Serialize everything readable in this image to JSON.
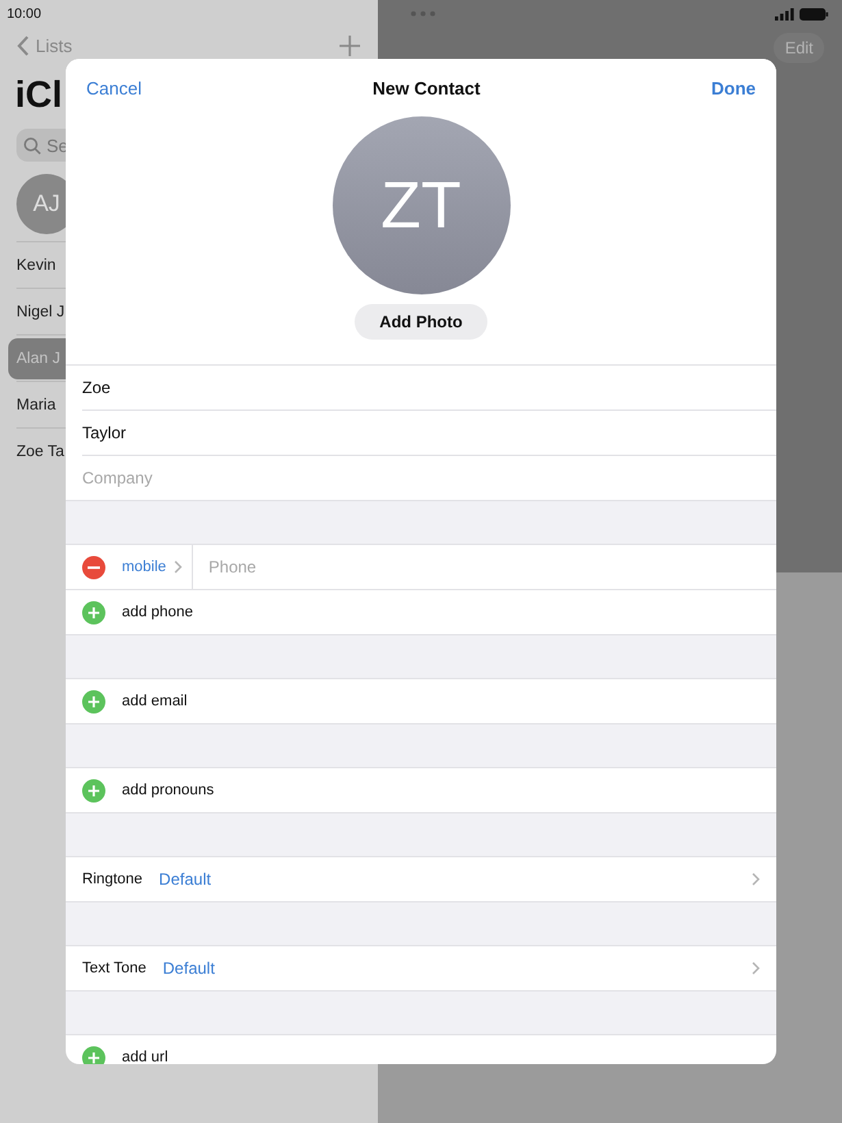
{
  "status_bar": {
    "time": "10:00"
  },
  "background": {
    "back": "Lists",
    "title": "iCl",
    "search_placeholder": "Se",
    "avatar_initials": "AJ",
    "edit": "Edit",
    "contacts": [
      {
        "name": "Kevin",
        "selected": false
      },
      {
        "name": "Nigel J",
        "selected": false
      },
      {
        "name": "Alan J",
        "selected": true
      },
      {
        "name": "Maria",
        "selected": false
      },
      {
        "name": "Zoe Ta",
        "selected": false
      }
    ]
  },
  "modal": {
    "cancel": "Cancel",
    "title": "New Contact",
    "done": "Done",
    "initials": "ZT",
    "add_photo": "Add Photo",
    "fields": [
      {
        "value": "Zoe"
      },
      {
        "value": "Taylor"
      },
      {
        "placeholder": "Company"
      }
    ],
    "sections": [
      [
        {
          "kind": "phone",
          "label": "mobile",
          "placeholder": "Phone"
        },
        {
          "kind": "add",
          "label": "add phone"
        }
      ],
      [
        {
          "kind": "add",
          "label": "add email"
        }
      ],
      [
        {
          "kind": "add",
          "label": "add pronouns"
        }
      ],
      [
        {
          "kind": "setting",
          "label": "Ringtone",
          "value": "Default"
        }
      ],
      [
        {
          "kind": "setting",
          "label": "Text Tone",
          "value": "Default"
        }
      ],
      [
        {
          "kind": "add",
          "label": "add url"
        }
      ]
    ]
  }
}
